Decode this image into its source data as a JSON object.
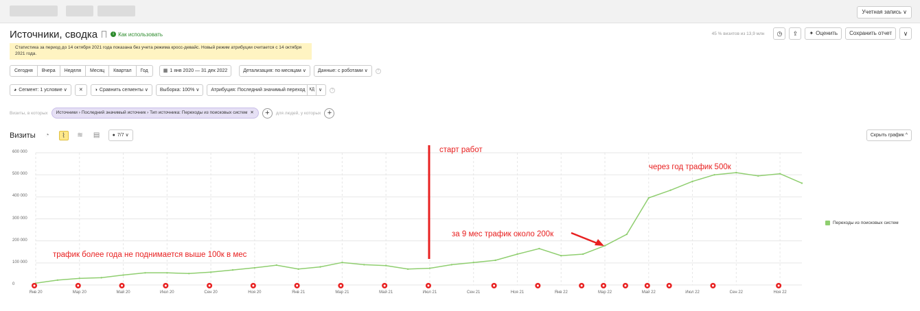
{
  "header": {
    "account_label": "Учетная запись ∨"
  },
  "page": {
    "title": "Источники, сводка",
    "howto_label": "Как использовать",
    "visits_info": "45 % визитов из 13,9 млн",
    "rate_label": "Оценить",
    "save_report_label": "Сохранить отчет",
    "notice": "Статистика за период до 14 октября 2021 года показана без учета режима кросс-девайс. Новый режим атрибуции считается с 14 октября 2021 года."
  },
  "period_buttons": [
    "Сегодня",
    "Вчера",
    "Неделя",
    "Месяц",
    "Квартал",
    "Год"
  ],
  "date_range": "1 янв 2020 — 31 дек 2022",
  "detail_label": "Детализация: по месяцам ∨",
  "data_label": "Данные: с роботами ∨",
  "segment_label": "Сегмент: 1 условие ∨",
  "compare_label": "Сравнить сегменты ∨",
  "sample_label": "Выборка: 100% ∨",
  "attribution_label": "Атрибуция: Последний значимый переход",
  "attribution_badge": "КД",
  "filter": {
    "prefix": "Визиты, в которых",
    "chip": "Источники › Последний значимый источник › Тип источника: Переходы из поисковых систем",
    "people_label": "для людей, у которых"
  },
  "chart_head": {
    "title": "Визиты",
    "series_count": "7/7 ∨",
    "hide_label": "Скрыть график ^"
  },
  "annotations": {
    "start": "старт работ",
    "year": "через год трафик 500к",
    "nine": "за 9 мес трафик около 200к",
    "before": "трафик более года не поднимается выше 100к в мес"
  },
  "colors": {
    "series": "#8fce6f",
    "annotation": "#e82020",
    "notice_bg": "#fff4c2"
  },
  "chart_data": {
    "type": "line",
    "series": [
      {
        "name": "Переходы из поисковых систем",
        "values": [
          8000,
          22000,
          30000,
          33000,
          45000,
          55000,
          55000,
          52000,
          58000,
          68000,
          78000,
          90000,
          72000,
          82000,
          102000,
          92000,
          88000,
          72000,
          76000,
          92000,
          102000,
          112000,
          140000,
          165000,
          133000,
          140000,
          178000,
          230000,
          395000,
          430000,
          470000,
          500000,
          510000,
          495000,
          505000,
          462000
        ]
      }
    ],
    "x_start": "2020-01",
    "x_ticks": [
      "Янв 20",
      "Мар 20",
      "Май 20",
      "Июл 20",
      "Сен 20",
      "Ноя 20",
      "Янв 21",
      "Мар 21",
      "Май 21",
      "Июл 21",
      "Сен 21",
      "Ноя 21",
      "Янв 22",
      "Мар 22",
      "Май 22",
      "Июл 22",
      "Сен 22",
      "Ноя 22"
    ],
    "y_ticks": [
      "600 000",
      "500 000",
      "400 000",
      "300 000",
      "200 000",
      "100 000",
      "0"
    ],
    "ylim": [
      0,
      600000
    ],
    "grid": true,
    "legend": "right"
  }
}
